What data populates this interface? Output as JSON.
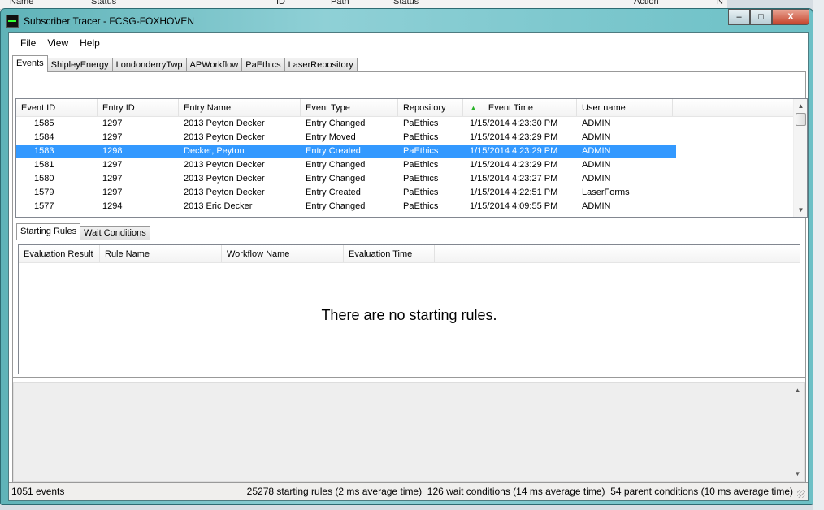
{
  "background": {
    "headers": [
      "Name",
      "Status",
      "ID",
      "Path",
      "Status",
      "Action",
      "N"
    ]
  },
  "window": {
    "title": "Subscriber Tracer - FCSG-FOXHOVEN",
    "minimize": "–",
    "maximize": "□",
    "close": "X"
  },
  "menu": [
    "File",
    "View",
    "Help"
  ],
  "tabs": [
    "Events",
    "ShipleyEnergy",
    "LondonderryTwp",
    "APWorkflow",
    "PaEthics",
    "LaserRepository"
  ],
  "events": {
    "columns": [
      "Event ID",
      "Entry ID",
      "Entry Name",
      "Event Type",
      "Repository",
      "Event Time",
      "User name"
    ],
    "sort_indicator": "▲",
    "rows": [
      [
        "1585",
        "1297",
        "2013 Peyton Decker",
        "Entry Changed",
        "PaEthics",
        "1/15/2014 4:23:30 PM",
        "ADMIN"
      ],
      [
        "1584",
        "1297",
        "2013 Peyton Decker",
        "Entry Moved",
        "PaEthics",
        "1/15/2014 4:23:29 PM",
        "ADMIN"
      ],
      [
        "1583",
        "1298",
        "Decker, Peyton",
        "Entry Created",
        "PaEthics",
        "1/15/2014 4:23:29 PM",
        "ADMIN"
      ],
      [
        "1581",
        "1297",
        "2013 Peyton Decker",
        "Entry Changed",
        "PaEthics",
        "1/15/2014 4:23:29 PM",
        "ADMIN"
      ],
      [
        "1580",
        "1297",
        "2013 Peyton Decker",
        "Entry Changed",
        "PaEthics",
        "1/15/2014 4:23:27 PM",
        "ADMIN"
      ],
      [
        "1579",
        "1297",
        "2013 Peyton Decker",
        "Entry Created",
        "PaEthics",
        "1/15/2014 4:22:51 PM",
        "LaserForms"
      ],
      [
        "1577",
        "1294",
        "2013 Eric Decker",
        "Entry Changed",
        "PaEthics",
        "1/15/2014 4:09:55 PM",
        "ADMIN"
      ]
    ],
    "selected_index": 2
  },
  "subtabs": [
    "Starting Rules",
    "Wait Conditions"
  ],
  "rules": {
    "columns": [
      "Evaluation Result",
      "Rule Name",
      "Workflow Name",
      "Evaluation Time"
    ],
    "empty_message": "There are no starting rules."
  },
  "status": {
    "left": "1051 events",
    "right": "25278 starting rules (2 ms average time)  126 wait conditions (14 ms average time)  54 parent conditions (10 ms average time)"
  },
  "colors": {
    "selection": "#3399ff",
    "sort_arrow": "#2bb32b"
  }
}
